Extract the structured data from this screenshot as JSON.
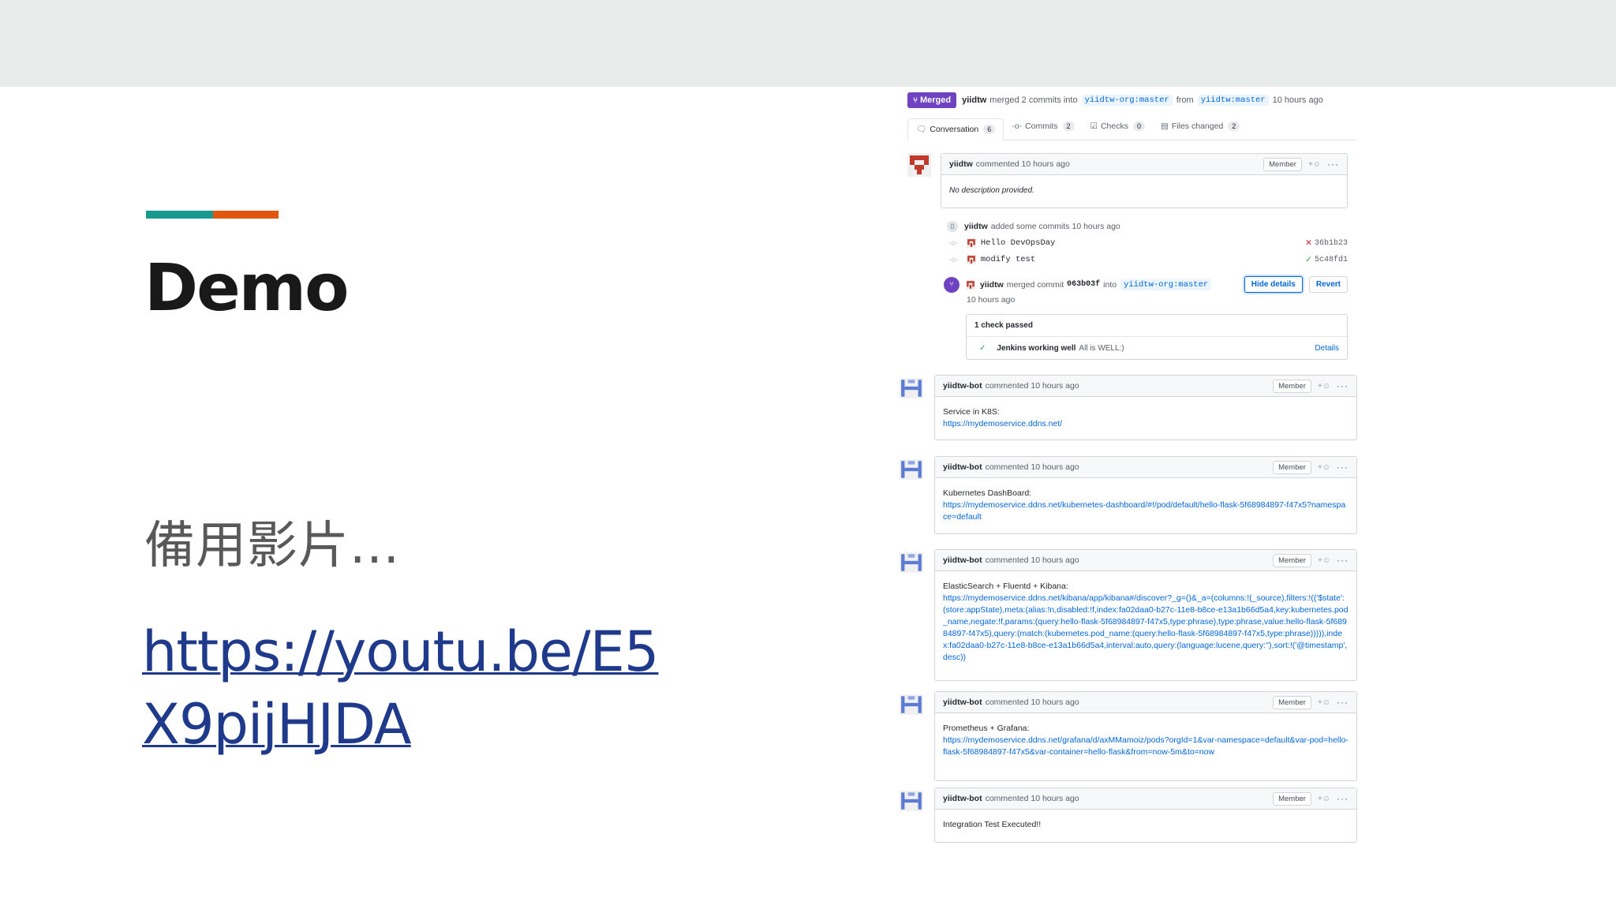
{
  "slide": {
    "title": "Demo",
    "subtitle": "備用影片...",
    "link": "https://youtu.be/E5X9pijHJDA",
    "accent_colors": [
      "#17998f",
      "#e2570f"
    ]
  },
  "pr": {
    "state": "Merged",
    "author": "yiidtw",
    "merged_text": "merged 2 commits into",
    "base_branch": "yiidtw-org:master",
    "from_text": "from",
    "head_branch": "yiidtw:master",
    "time": "10 hours ago",
    "tabs": [
      {
        "icon": "conversation-icon",
        "label": "Conversation",
        "count": "6"
      },
      {
        "icon": "commits-icon",
        "label": "Commits",
        "count": "2"
      },
      {
        "icon": "checks-icon",
        "label": "Checks",
        "count": "0"
      },
      {
        "icon": "files-icon",
        "label": "Files changed",
        "count": "2"
      }
    ]
  },
  "first_comment": {
    "author": "yiidtw",
    "action": "commented 10 hours ago",
    "badge": "Member",
    "body": "No description provided."
  },
  "timeline": {
    "added_author": "yiidtw",
    "added_text": "added some commits 10 hours ago",
    "commits": [
      {
        "message": "Hello DevOpsDay",
        "sha": "36b1b23",
        "status": "✕"
      },
      {
        "message": "modify test",
        "sha": "5c48fd1",
        "status": "✓"
      }
    ],
    "merge_author": "yiidtw",
    "merge_text": "merged commit",
    "merge_sha": "063b03f",
    "merge_into": "into",
    "merge_branch": "yiidtw-org:master",
    "merge_time": "10 hours ago",
    "hide_details": "Hide details",
    "revert": "Revert",
    "checks_header": "1 check passed",
    "check_name": "Jenkins working well",
    "check_desc": "All is WELL:)",
    "check_details": "Details"
  },
  "bot_comments": [
    {
      "author": "yiidtw-bot",
      "action": "commented 10 hours ago",
      "badge": "Member",
      "label": "Service in K8S:",
      "url": "https://mydemoservice.ddns.net/"
    },
    {
      "author": "yiidtw-bot",
      "action": "commented 10 hours ago",
      "badge": "Member",
      "label": "Kubernetes DashBoard:",
      "url": "https://mydemoservice.ddns.net/kubernetes-dashboard/#!/pod/default/hello-flask-5f68984897-f47x5?namespace=default"
    },
    {
      "author": "yiidtw-bot",
      "action": "commented 10 hours ago",
      "badge": "Member",
      "label": "ElasticSearch + Fluentd + Kibana:",
      "url": "https://mydemoservice.ddns.net/kibana/app/kibana#/discover?_g=()&_a=(columns:!(_source),filters:!(('$state':(store:appState),meta:(alias:!n,disabled:!f,index:fa02daa0-b27c-11e8-b8ce-e13a1b66d5a4,key:kubernetes.pod_name,negate:!f,params:(query:hello-flask-5f68984897-f47x5,type:phrase),type:phrase,value:hello-flask-5f68984897-f47x5),query:(match:(kubernetes.pod_name:(query:hello-flask-5f68984897-f47x5,type:phrase))))),index:fa02daa0-b27c-11e8-b8ce-e13a1b66d5a4,interval:auto,query:(language:lucene,query:''),sort:!('@timestamp',desc))"
    },
    {
      "author": "yiidtw-bot",
      "action": "commented 10 hours ago",
      "badge": "Member",
      "label": "Prometheus + Grafana:",
      "url": "https://mydemoservice.ddns.net/grafana/d/axMMamoiz/pods?orgId=1&var-namespace=default&var-pod=hello-flask-5f68984897-f47x5&var-container=hello-flask&from=now-5m&to=now"
    },
    {
      "author": "yiidtw-bot",
      "action": "commented 10 hours ago",
      "badge": "Member",
      "label": "Integration Test Executed!!",
      "url": ""
    }
  ]
}
